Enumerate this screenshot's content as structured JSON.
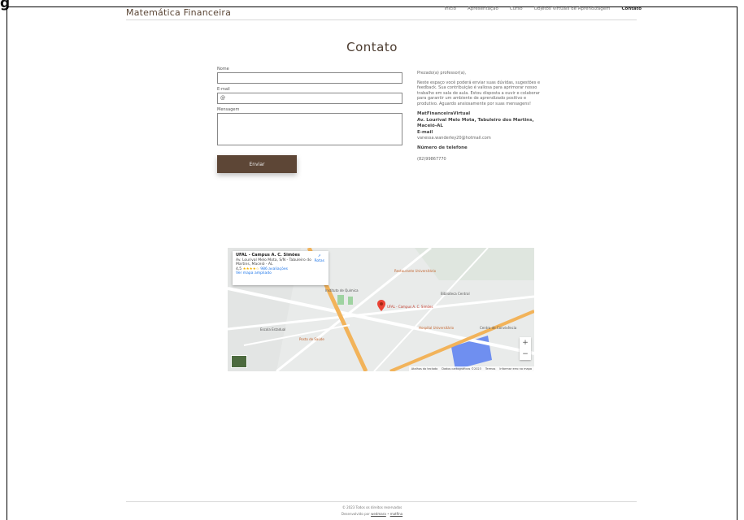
{
  "figure_caption": "g",
  "nav": {
    "brand": "Matemática Financeira",
    "links": [
      "Início",
      "Apresentação",
      "Curso",
      "Objetos Virtuais de Aprendizagem",
      "Contato"
    ]
  },
  "page": {
    "title": "Contato"
  },
  "form": {
    "name_label": "Nome",
    "name_value": "",
    "email_label": "E-mail",
    "email_value": "@",
    "message_label": "Mensagem",
    "message_value": "",
    "submit_label": "Enviar"
  },
  "info": {
    "greeting": "Prezado(a) professor(a),",
    "intro": "Neste espaço você poderá enviar suas dúvidas, sugestões e feedback. Sua contribuição é valiosa para aprimorar nosso trabalho em sala de aula. Estou disposta a ouvir e colaborar para garantir um ambiente de aprendizado positivo e produtivo. Aguardo ansiosamente por suas mensagens!",
    "org_heading": "MatFinanceiraVirtual",
    "address": "Av. Lourival Melo Mota, Tabuleiro dos Martins, Maceió-AL",
    "email_heading": "E-mail",
    "email_value": "vanessa.wanderley20@hotmail.com",
    "phone_heading": "Número de telefone",
    "phone_value": "(82)99867770"
  },
  "map": {
    "place_name": "UFAL - Campus A. C. Simões",
    "place_address": "Av. Lourival Melo Mota, S/N - Tabuleiro do Martins, Maceió - AL",
    "rating": "4,5",
    "reviews": "986 avaliações",
    "enlarge_link": "Ver mapa ampliado",
    "route_label": "Rotas",
    "zoom_in": "+",
    "zoom_out": "−",
    "attribution": [
      "Atalhos do teclado",
      "Dados cartográficos ©2023",
      "Termos",
      "Informar erro no mapa"
    ],
    "labels": [
      "UFAL - Campus A. C. Simões",
      "Restaurante Universitário",
      "Hospital Universitário",
      "Instituto de Química",
      "Biblioteca Central",
      "Escola Estadual",
      "Posto de Saúde",
      "Centro de Convivência"
    ]
  },
  "footer": {
    "copyright": "© 2023 Todos os direitos reservados",
    "developed_by": "Desenvolvido por",
    "dev_link_1": "wedmara",
    "separator": "•",
    "dev_link_2": "matfina"
  },
  "colors": {
    "brand": "#5d4636",
    "text": "#333333",
    "map_road": "#f2b35a"
  }
}
